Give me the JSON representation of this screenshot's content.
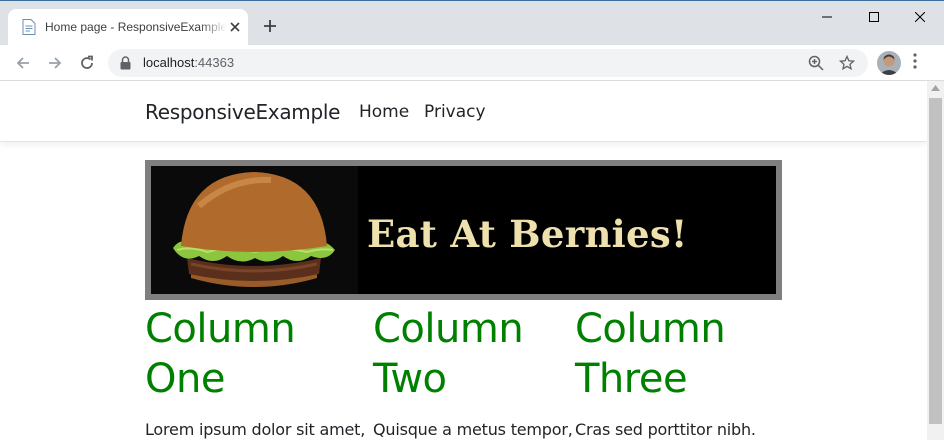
{
  "browser": {
    "tab_title": "Home page - ResponsiveExample",
    "url_host": "localhost",
    "url_port": ":44363"
  },
  "site": {
    "brand": "ResponsiveExample",
    "nav": {
      "home": "Home",
      "privacy": "Privacy"
    },
    "banner_text": "Eat At Bernies!",
    "columns": [
      {
        "heading_1": "Column",
        "heading_2": "One",
        "text": "Lorem ipsum dolor sit amet,"
      },
      {
        "heading_1": "Column",
        "heading_2": "Two",
        "text": "Quisque a metus tempor,"
      },
      {
        "heading_1": "Column",
        "heading_2": "Three",
        "text": "Cras sed porttitor nibh."
      }
    ]
  },
  "colors": {
    "column_heading": "#008000",
    "banner_border": "#7f7f7f",
    "banner_text": "#efe1ad"
  },
  "icons": [
    "page-favicon-icon",
    "close-icon",
    "plus-icon",
    "minimize-icon",
    "maximize-icon",
    "window-close-icon",
    "back-arrow-icon",
    "forward-arrow-icon",
    "reload-icon",
    "lock-icon",
    "zoom-icon",
    "star-icon",
    "kebab-menu-icon"
  ]
}
